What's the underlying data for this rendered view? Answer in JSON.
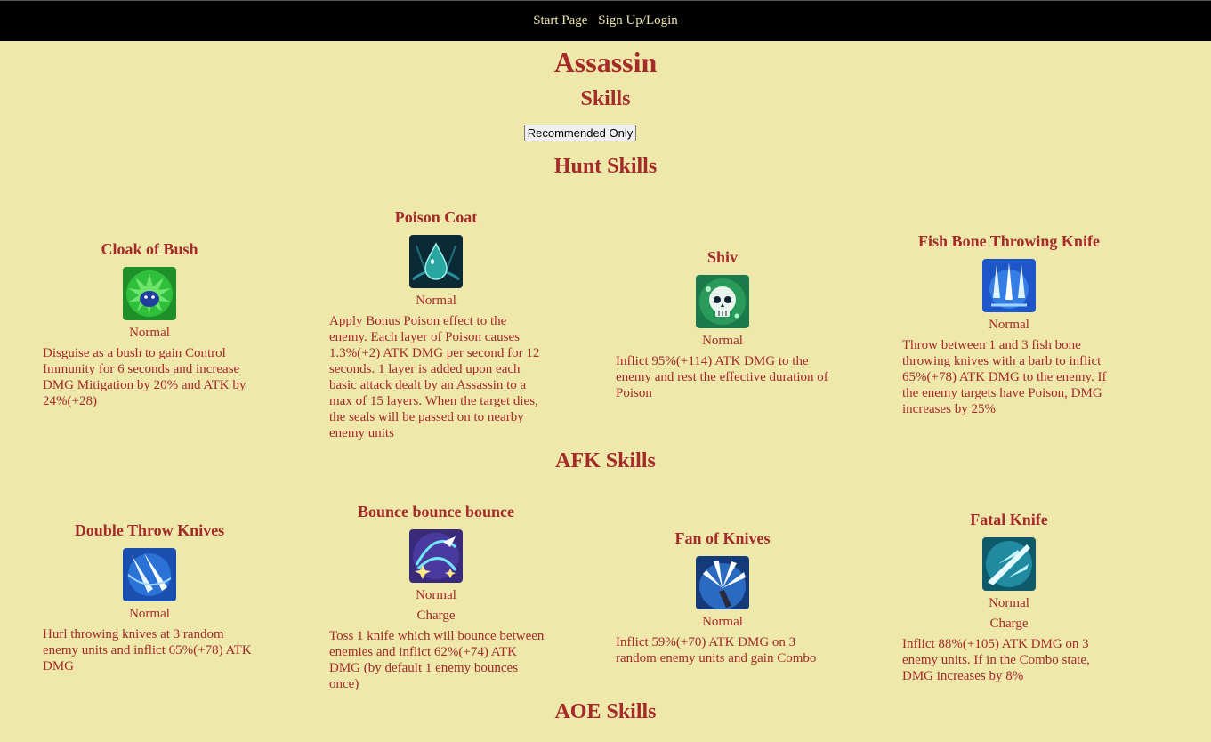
{
  "nav": {
    "start_page": "Start Page",
    "signup_login": "Sign Up/Login"
  },
  "page": {
    "title": "Assassin",
    "skills_heading": "Skills",
    "recommended_button": "Recommended Only"
  },
  "sections": {
    "hunt": {
      "heading": "Hunt Skills",
      "cards": [
        {
          "name": "Cloak of Bush",
          "icon": "bush-icon",
          "type": "Normal",
          "desc": "Disguise as a bush to gain Control Immunity for 6 seconds and increase DMG Mitigation by 20% and ATK by 24%(+28)"
        },
        {
          "name": "Poison Coat",
          "icon": "poison-drop-icon",
          "type": "Normal",
          "desc": "Apply Bonus Poison effect to the enemy. Each layer of Poison causes 1.3%(+2) ATK DMG per second for 12 seconds. 1 layer is added upon each basic attack dealt by an Assassin to a max of 15 layers. When the target dies, the seals will be passed on to nearby enemy units"
        },
        {
          "name": "Shiv",
          "icon": "skull-icon",
          "type": "Normal",
          "desc": "Inflict 95%(+114) ATK DMG to the enemy and rest the effective duration of Poison"
        },
        {
          "name": "Fish Bone Throwing Knife",
          "icon": "fish-bone-knives-icon",
          "type": "Normal",
          "desc": "Throw between 1 and 3 fish bone throwing knives with a barb to inflict 65%(+78) ATK DMG to the enemy. If the enemy targets have Poison, DMG increases by 25%"
        }
      ]
    },
    "afk": {
      "heading": "AFK Skills",
      "cards": [
        {
          "name": "Double Throw Knives",
          "icon": "double-knives-icon",
          "type": "Normal",
          "desc": "Hurl throwing knives at 3 random enemy units and inflict 65%(+78) ATK DMG"
        },
        {
          "name": "Bounce bounce bounce",
          "icon": "bounce-knife-icon",
          "type": "Normal",
          "type2": "Charge",
          "desc": "Toss 1 knife which will bounce between enemies and inflict 62%(+74) ATK DMG (by default 1 enemy bounces once)"
        },
        {
          "name": "Fan of Knives",
          "icon": "fan-knives-icon",
          "type": "Normal",
          "desc": "Inflict 59%(+70) ATK DMG on 3 random enemy units and gain Combo"
        },
        {
          "name": "Fatal Knife",
          "icon": "fatal-knife-icon",
          "type": "Normal",
          "type2": "Charge",
          "desc": "Inflict 88%(+105) ATK DMG on 3 enemy units. If in the Combo state, DMG increases by 8%"
        }
      ]
    },
    "aoe": {
      "heading": "AOE Skills"
    }
  },
  "colors": {
    "background": "#EEE8AA",
    "text": "#A52A2A",
    "navbar": "#000000",
    "nav_link": "#EEE8AA"
  }
}
